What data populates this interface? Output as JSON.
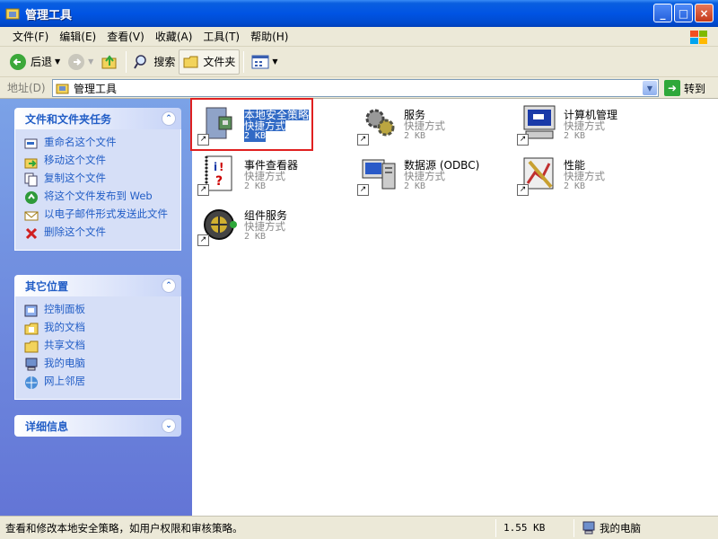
{
  "window": {
    "title": "管理工具",
    "controls": {
      "minimize": "_",
      "maximize": "□",
      "close": "×"
    }
  },
  "menubar": {
    "items": [
      "文件(F)",
      "编辑(E)",
      "查看(V)",
      "收藏(A)",
      "工具(T)",
      "帮助(H)"
    ]
  },
  "toolbar": {
    "back_label": "后退",
    "search_label": "搜索",
    "folders_label": "文件夹"
  },
  "address": {
    "label": "地址(D)",
    "value": "管理工具",
    "go_label": "转到"
  },
  "file_tasks": {
    "title": "文件和文件夹任务",
    "items": [
      "重命名这个文件",
      "移动这个文件",
      "复制这个文件",
      "将这个文件发布到 Web",
      "以电子邮件形式发送此文件",
      "删除这个文件"
    ]
  },
  "other_places": {
    "title": "其它位置",
    "items": [
      "控制面板",
      "我的文档",
      "共享文档",
      "我的电脑",
      "网上邻居"
    ]
  },
  "details": {
    "title": "详细信息"
  },
  "files": [
    {
      "name": "本地安全策略",
      "type": "快捷方式",
      "size": "2 KB"
    },
    {
      "name": "服务",
      "type": "快捷方式",
      "size": "2 KB"
    },
    {
      "name": "计算机管理",
      "type": "快捷方式",
      "size": "2 KB"
    },
    {
      "name": "事件查看器",
      "type": "快捷方式",
      "size": "2 KB"
    },
    {
      "name": "数据源 (ODBC)",
      "type": "快捷方式",
      "size": "2 KB"
    },
    {
      "name": "性能",
      "type": "快捷方式",
      "size": "2 KB"
    },
    {
      "name": "组件服务",
      "type": "快捷方式",
      "size": "2 KB"
    }
  ],
  "status": {
    "text": "查看和修改本地安全策略，如用户权限和审核策略。",
    "size": "1.55 KB",
    "location": "我的电脑"
  },
  "colors": {
    "title_bar": "#0054e3",
    "task_pane": "#6375d6",
    "link": "#215dc6",
    "selection": "#316ac5",
    "highlight_box": "#e02020"
  }
}
